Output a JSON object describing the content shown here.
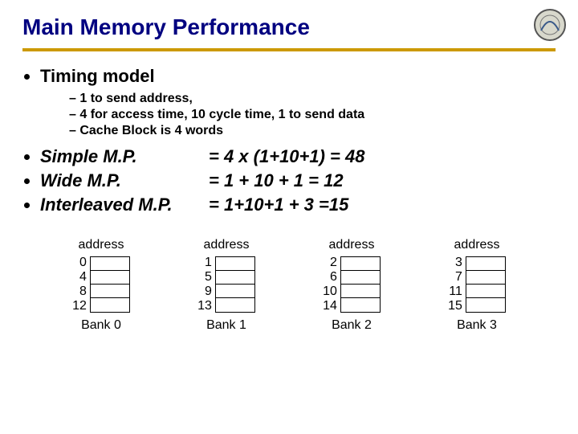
{
  "title": "Main Memory Performance",
  "bullets": {
    "timing_heading": "Timing model",
    "timing_sub": [
      "1 to send address,",
      "4 for access time, 10 cycle time, 1 to send data",
      "Cache Block is 4 words"
    ],
    "calcs": [
      {
        "name": "Simple M.P.",
        "expr": "= 4 x (1+10+1) = 48"
      },
      {
        "name": "Wide M.P.",
        "expr": "= 1 + 10 + 1        = 12"
      },
      {
        "name": "Interleaved M.P.",
        "expr": "= 1+10+1 + 3 =15"
      }
    ]
  },
  "banks_header": "address",
  "banks": [
    {
      "nums": [
        "0",
        "4",
        "8",
        "12"
      ],
      "label": "Bank 0"
    },
    {
      "nums": [
        "1",
        "5",
        "9",
        "13"
      ],
      "label": "Bank 1"
    },
    {
      "nums": [
        "2",
        "6",
        "10",
        "14"
      ],
      "label": "Bank 2"
    },
    {
      "nums": [
        "3",
        "7",
        "11",
        "15"
      ],
      "label": "Bank 3"
    }
  ]
}
